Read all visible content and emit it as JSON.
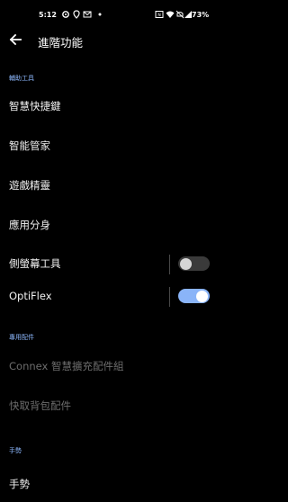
{
  "status_bar": {
    "time": "5:12",
    "battery": "73%",
    "icons": [
      "settings-gear-icon",
      "location-pin-icon",
      "mail-icon",
      "dot-icon",
      "nfc-icon",
      "wifi-icon",
      "mute-icon",
      "signal-icon",
      "battery-icon"
    ]
  },
  "header": {
    "title": "進階功能",
    "back_icon": "back-arrow-icon"
  },
  "sections": {
    "assist": "輔助工具",
    "accessories": "專用配件",
    "gestures": "手勢"
  },
  "items": {
    "smart_key": "智慧快捷鍵",
    "smart_butler": "智能管家",
    "game_genie": "遊戲精靈",
    "twin_apps": "應用分身",
    "edge_tools": "側螢幕工具",
    "optiflex": "OptiFlex",
    "connex": "Connex 智慧擴充配件組",
    "backpack": "快取背包配件",
    "gestures_partial": "手勢"
  },
  "toggles": {
    "edge_tools_on": false,
    "optiflex_on": true
  },
  "colors": {
    "accent": "#8ab4f8",
    "background": "#000000"
  }
}
